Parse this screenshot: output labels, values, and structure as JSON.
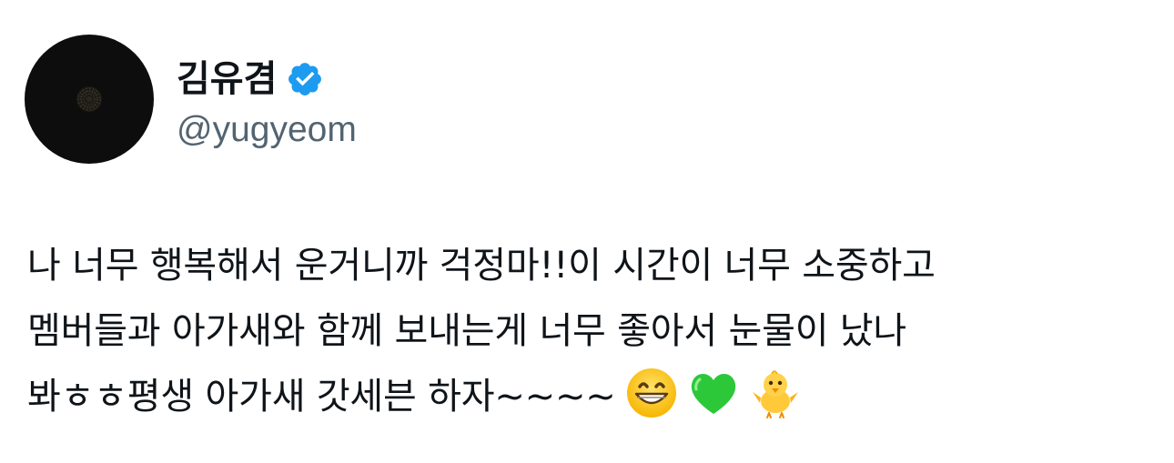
{
  "tweet": {
    "author": {
      "display_name": "김유겸",
      "handle": "@yugyeom",
      "verified": true,
      "verified_badge_color": "#1d9bf0",
      "avatar_icon": "dark-flower-avatar"
    },
    "text_lines": [
      "나 너무 행복해서 운거니까 걱정마!!이 시간이 너무 소중하고",
      "멤버들과 아가새와 함께 보내는게 너무 좋아서 눈물이 났나",
      "봐ㅎㅎ평생 아가새 갓세븐 하자~~~~"
    ],
    "emojis": [
      "grinning-face-emoji",
      "green-heart-emoji",
      "front-facing-baby-chick-emoji"
    ]
  },
  "colors": {
    "text_primary": "#0f1419",
    "text_secondary": "#536471",
    "background": "#ffffff",
    "verified_blue": "#1d9bf0"
  }
}
